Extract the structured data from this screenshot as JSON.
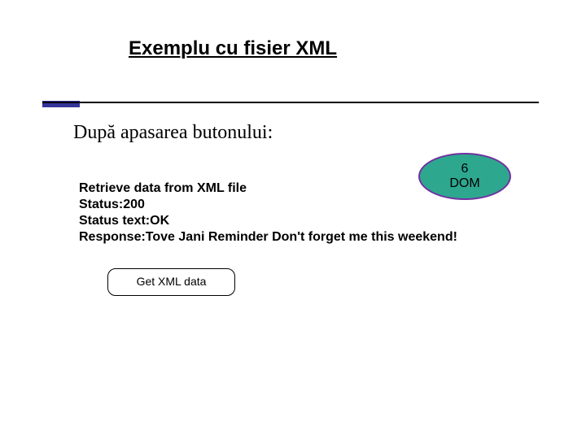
{
  "title": "Exemplu cu fisier XML",
  "subtitle": "După apasarea butonului:",
  "callout": {
    "line1": "6",
    "line2": "DOM"
  },
  "body": {
    "line1": "Retrieve data from XML file",
    "status_label": "Status:",
    "status_value": "200",
    "status_text_label": "Status text:",
    "status_text_value": "OK",
    "response_label": "Response:",
    "response_value": "Tove Jani Reminder Don't forget me this weekend!"
  },
  "button_label": "Get XML data"
}
